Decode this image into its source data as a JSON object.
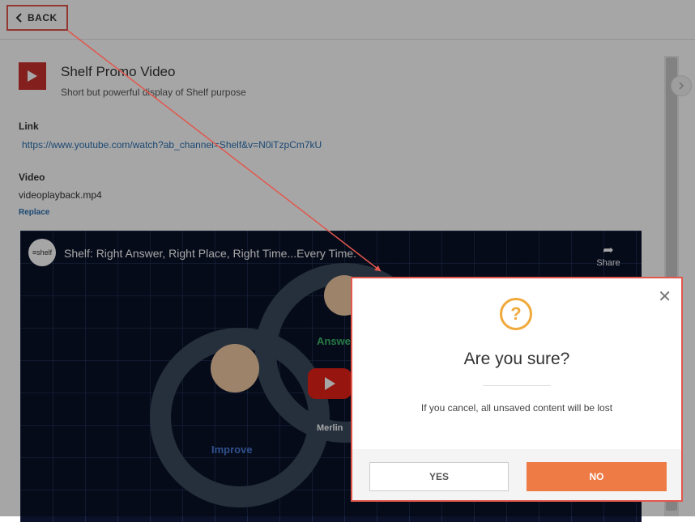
{
  "header": {
    "back_label": "BACK"
  },
  "item": {
    "title": "Shelf Promo Video",
    "subtitle": "Short but powerful display of Shelf purpose",
    "link_label": "Link",
    "link_url": "https://www.youtube.com/watch?ab_channel=Shelf&v=N0iTzpCm7kU",
    "video_label": "Video",
    "video_file": "videoplayback.mp4",
    "replace_label": "Replace"
  },
  "player": {
    "channel_logo_text": "≡shelf",
    "title": "Shelf: Right Answer, Right Place, Right Time...Every Time.",
    "share_label": "Share",
    "captions": [
      "Improve",
      "Answer",
      "Merlin"
    ]
  },
  "dialog": {
    "title": "Are you sure?",
    "message": "If you cancel, all unsaved content will be lost",
    "yes_label": "YES",
    "no_label": "NO",
    "close_glyph": "✕",
    "icon_glyph": "?"
  },
  "colors": {
    "accent_orange": "#ee7a45",
    "annotation_red": "#e2574c",
    "question_icon": "#f0a93b",
    "link_blue": "#2a6fb0"
  }
}
